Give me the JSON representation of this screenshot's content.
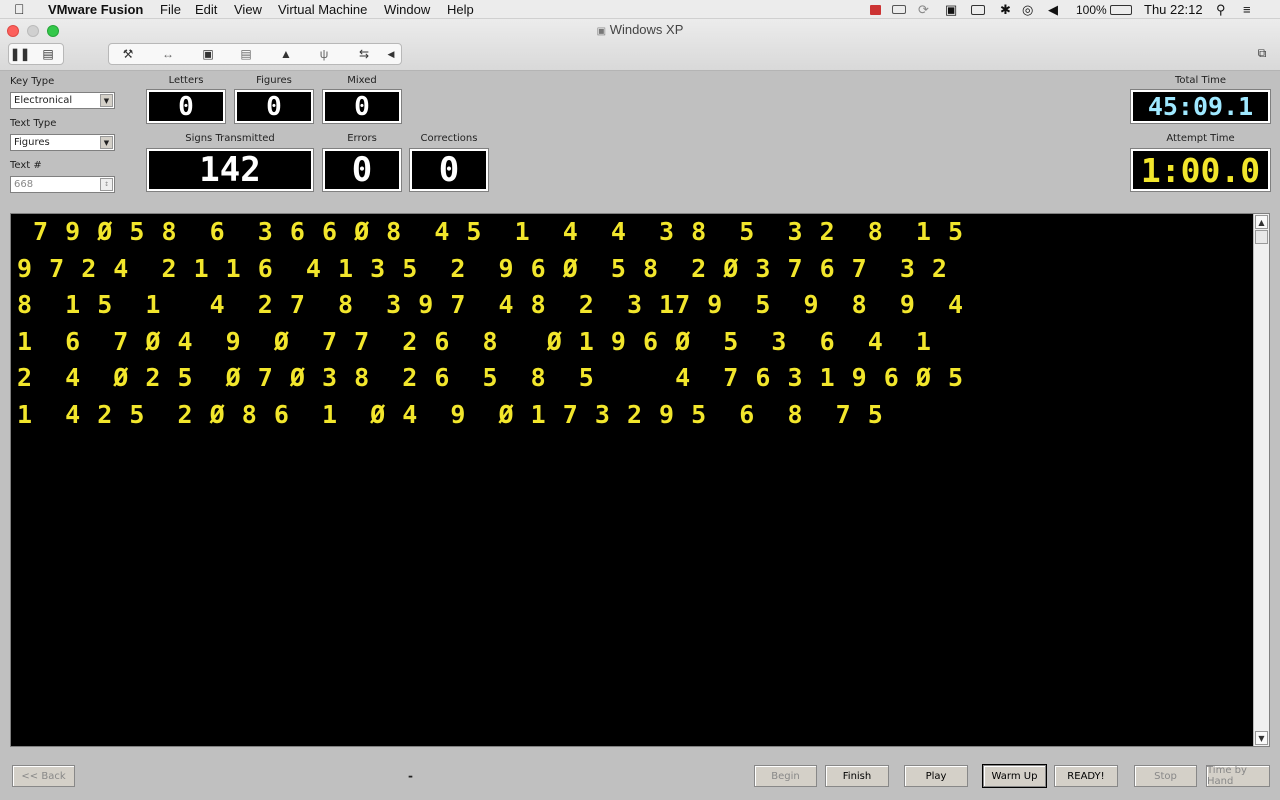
{
  "menubar": {
    "apple": "",
    "app_name": "VMware Fusion",
    "items": [
      "File",
      "Edit",
      "View",
      "Virtual Machine",
      "Window",
      "Help"
    ],
    "battery": "100%",
    "clock": "Thu 22:12"
  },
  "window": {
    "title": "Windows XP"
  },
  "controls": {
    "key_type_label": "Key Type",
    "key_type_value": "Electronical",
    "text_type_label": "Text Type",
    "text_type_value": "Figures",
    "text_num_label": "Text #",
    "text_num_value": "668"
  },
  "counters": {
    "letters_label": "Letters",
    "letters": "0",
    "figures_label": "Figures",
    "figures": "0",
    "mixed_label": "Mixed",
    "mixed": "0",
    "signs_label": "Signs Transmitted",
    "signs": "142",
    "errors_label": "Errors",
    "errors": "0",
    "corrections_label": "Corrections",
    "corrections": "0"
  },
  "timers": {
    "total_label": "Total Time",
    "total": "45:09.1",
    "total_color": "#9fe8ff",
    "attempt_label": "Attempt Time",
    "attempt": "1:00.0",
    "attempt_color": "#f2e62c"
  },
  "text_lines": [
    " 7 9 Ø 5 8  6  3 6 6 Ø 8  4 5  1  4  4  3 8  5  3 2  8  1 5",
    "9 7 2 4  2 1 1 6  4 1 3 5  2  9 6 Ø  5 8  2 Ø 3 7 6 7  3 2",
    "8  1 5  1   4  2 7  8  3 9 7  4 8  2  3 17 9  5  9  8  9  4",
    "1  6  7 Ø 4  9  Ø  7 7  2 6  8   Ø 1 9 6 Ø  5  3  6  4  1",
    "2  4  Ø 2 5  Ø 7 Ø 3 8  2 6  5  8  5     4  7 6 3 1 9 6 Ø 5",
    "1  4 2 5  2 Ø 8 6  1  Ø 4  9  Ø 1 7 3 2 9 5  6  8  7 5"
  ],
  "status_text": "-",
  "buttons": {
    "back": "<< Back",
    "begin": "Begin",
    "finish": "Finish",
    "play": "Play",
    "warm_up": "Warm Up",
    "ready": "READY!",
    "stop": "Stop",
    "time_by_hand": "Time by Hand"
  }
}
